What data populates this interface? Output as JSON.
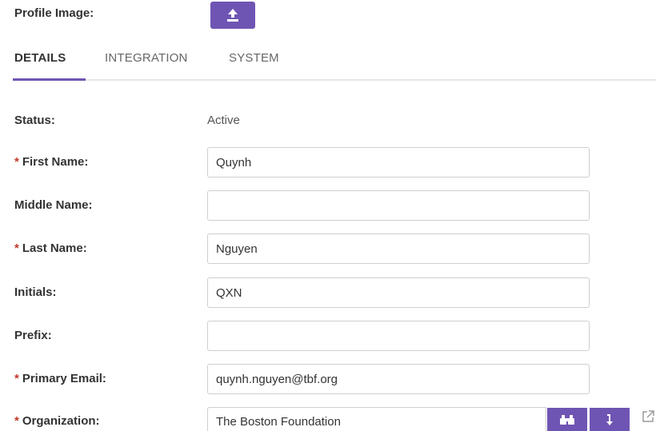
{
  "profile": {
    "label": "Profile Image:",
    "upload_icon": "upload-icon"
  },
  "tabs": [
    {
      "label": "DETAILS",
      "active": true
    },
    {
      "label": "INTEGRATION",
      "active": false
    },
    {
      "label": "SYSTEM",
      "active": false
    }
  ],
  "fields": {
    "status": {
      "label": "Status:",
      "value": "Active"
    },
    "first_name": {
      "label": "First Name:",
      "required_mark": "*",
      "value": "Quynh"
    },
    "middle_name": {
      "label": "Middle Name:",
      "value": ""
    },
    "last_name": {
      "label": "Last Name:",
      "required_mark": "*",
      "value": "Nguyen"
    },
    "initials": {
      "label": "Initials:",
      "value": "QXN"
    },
    "prefix": {
      "label": "Prefix:",
      "value": ""
    },
    "primary_email": {
      "label": "Primary Email:",
      "required_mark": "*",
      "value": "quynh.nguyen@tbf.org"
    },
    "organization": {
      "label": "Organization:",
      "required_mark": "*",
      "value": "The Boston Foundation",
      "search_icon": "binoculars-icon",
      "select_icon": "arrow-down-icon",
      "open_icon": "external-link-icon"
    }
  },
  "colors": {
    "accent": "#6f55b3",
    "required": "#c0392b",
    "border": "#cfcfcf"
  }
}
